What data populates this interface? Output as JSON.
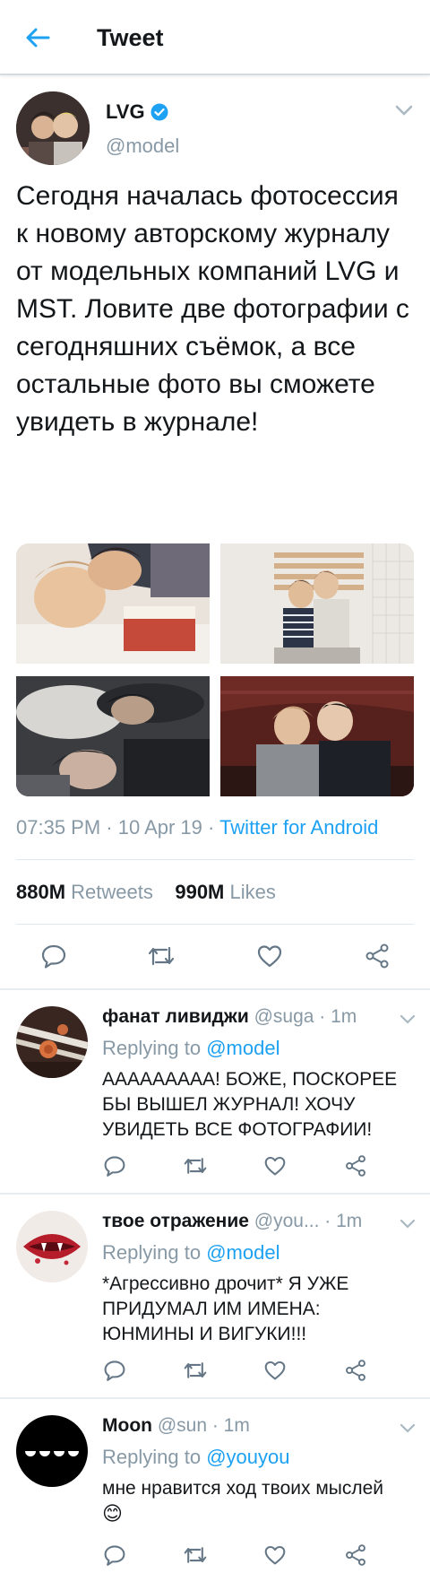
{
  "header": {
    "title": "Tweet"
  },
  "tweet": {
    "author": {
      "name": "LVG",
      "handle": "@model",
      "verified": true
    },
    "text": "Сегодня началась фотосессия к новому авторскому журналу от модельных компаний LVG и  MST. Ловите две фотографии с сегодняшних съёмок, а все остальные фото вы сможете увидеть в журнале!",
    "media": [
      {
        "name": "photo-1"
      },
      {
        "name": "photo-2"
      },
      {
        "name": "photo-3"
      },
      {
        "name": "photo-4"
      }
    ],
    "time": "07:35 PM · 10 Apr 19 · ",
    "client": "Twitter for Android",
    "retweets_count": "880M",
    "retweets_label": "Retweets",
    "likes_count": "990M",
    "likes_label": "Likes"
  },
  "replies": [
    {
      "name": "фанат ливиджи",
      "handle": "@suga",
      "time": "· 1m",
      "replying_label": "Replying to",
      "replying_to": "@model",
      "text": "ААААААААА! БОЖЕ, ПОСКОРЕЕ БЫ ВЫШЕЛ ЖУРНАЛ! ХОЧУ УВИДЕТЬ ВСЕ ФОТОГРАФИИ!"
    },
    {
      "name": "твое отражение",
      "handle": "@you...",
      "time": "· 1m",
      "replying_label": "Replying to",
      "replying_to": "@model",
      "text": "*Агрессивно дрочит* Я УЖЕ ПРИДУМАЛ ИМ ИМЕНА: ЮНМИНЫ И ВИГУКИ!!!"
    },
    {
      "name": "Moon",
      "handle": "@sun",
      "time": "· 1m",
      "replying_label": "Replying to",
      "replying_to": "@youyou",
      "text": "мне нравится ход твоих мыслей",
      "emoji": "😊"
    }
  ],
  "colors": {
    "accent": "#1da1f2",
    "muted": "#8899a6",
    "text": "#14171a",
    "divider": "#e1e8ed"
  },
  "icons": [
    "back-arrow-icon",
    "verified-badge-icon",
    "chevron-down-icon",
    "reply-icon",
    "retweet-icon",
    "like-icon",
    "share-icon"
  ]
}
